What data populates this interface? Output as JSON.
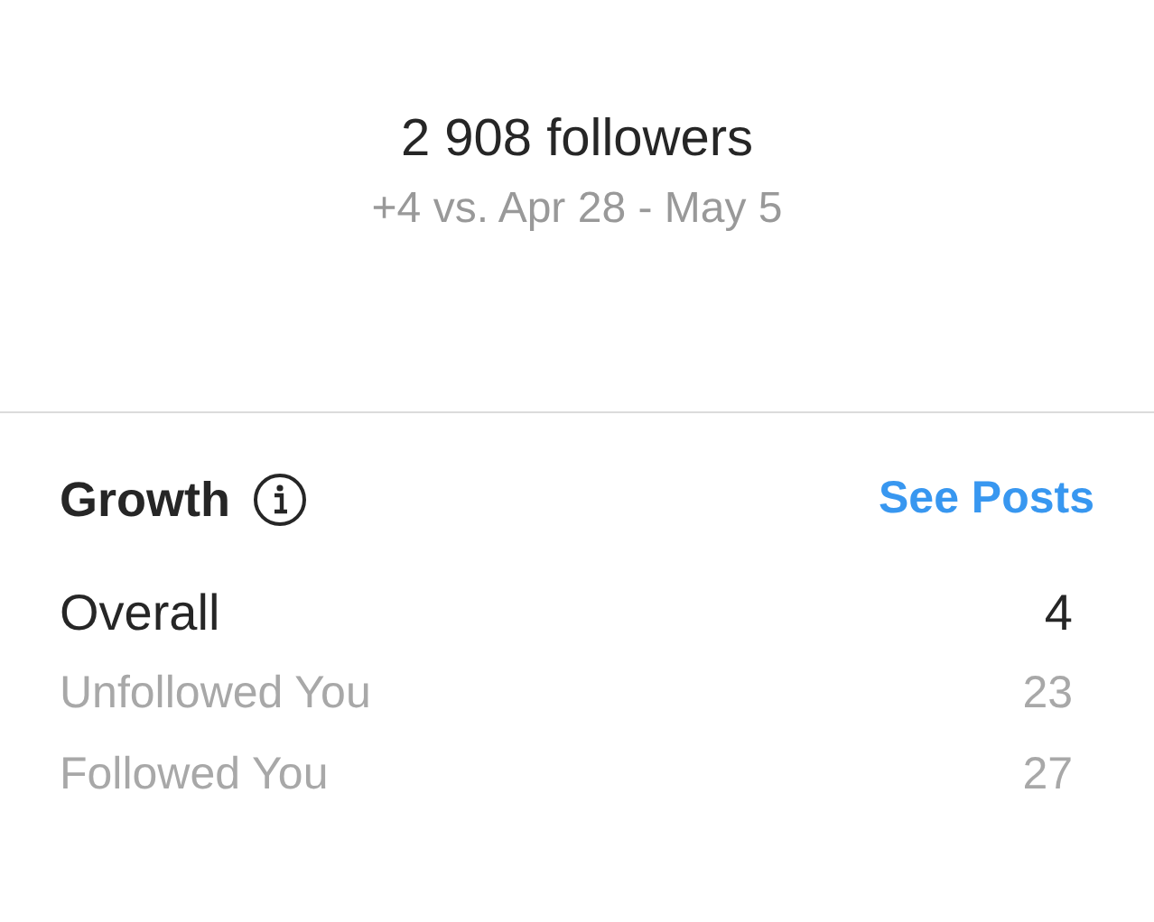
{
  "header": {
    "title": "2 908 followers",
    "subtitle": "+4 vs. Apr 28 - May 5"
  },
  "growth": {
    "title": "Growth",
    "link": "See Posts",
    "rows": [
      {
        "kind": "total",
        "label": "Overall",
        "value": "4"
      },
      {
        "kind": "detail",
        "label": "Unfollowed You",
        "value": "23"
      },
      {
        "kind": "detail",
        "label": "Followed You",
        "value": "27"
      }
    ]
  }
}
